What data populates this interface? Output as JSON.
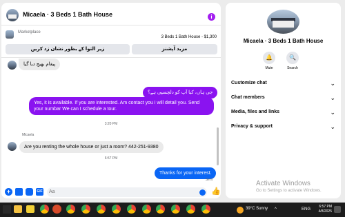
{
  "chat": {
    "title": "Micaela · 3 Beds 1 Bath House",
    "listing": {
      "label": "Marketplace",
      "detail": "3 Beds 1 Bath House - $1,300",
      "buttons": [
        "زیر التوا کے بطور نشان زد کریں",
        "مزید آپشنز"
      ]
    },
    "messages": [
      {
        "type": "incoming",
        "text": "پیغام بھیج دیا گیا"
      },
      {
        "type": "outgoing",
        "text": "جی ہاں، کیا آپ کو دلچسپی ہے؟"
      },
      {
        "type": "outgoing",
        "text": "Yes, it is available. If you are interested. Am contact you i will detail you. Send your numbar We can I schedule a tour."
      },
      {
        "type": "incoming",
        "text": "Are you renting the whole house or just a room? 442-251-9380"
      },
      {
        "type": "outgoing",
        "text": "Thanks for your interest."
      }
    ],
    "timestamps": [
      "3:20 PM",
      "6:57 PM"
    ],
    "sender_name": "Micaela",
    "sent_status": "Sent",
    "composer": {
      "placeholder": "Aa",
      "gif_label": "GIF"
    }
  },
  "info": {
    "name": "Micaela · 3 Beds 1 Bath House",
    "actions": [
      {
        "label": "Mute",
        "icon": "bell-icon"
      },
      {
        "label": "Search",
        "icon": "search-icon"
      }
    ],
    "rows": [
      "Customize chat",
      "Chat members",
      "Media, files and links",
      "Privacy & support"
    ]
  },
  "watermark": {
    "title": "Activate Windows",
    "subtitle": "Go to Settings to activate Windows."
  },
  "taskbar": {
    "weather": "39°C  Sunny",
    "language": "ENG",
    "time": "6:57 PM",
    "date": "4/8/2025"
  },
  "colors": {
    "outgoing": "#8a13f0",
    "outgoing_latest": "#0a66f5",
    "accent": "#0a66f5"
  }
}
